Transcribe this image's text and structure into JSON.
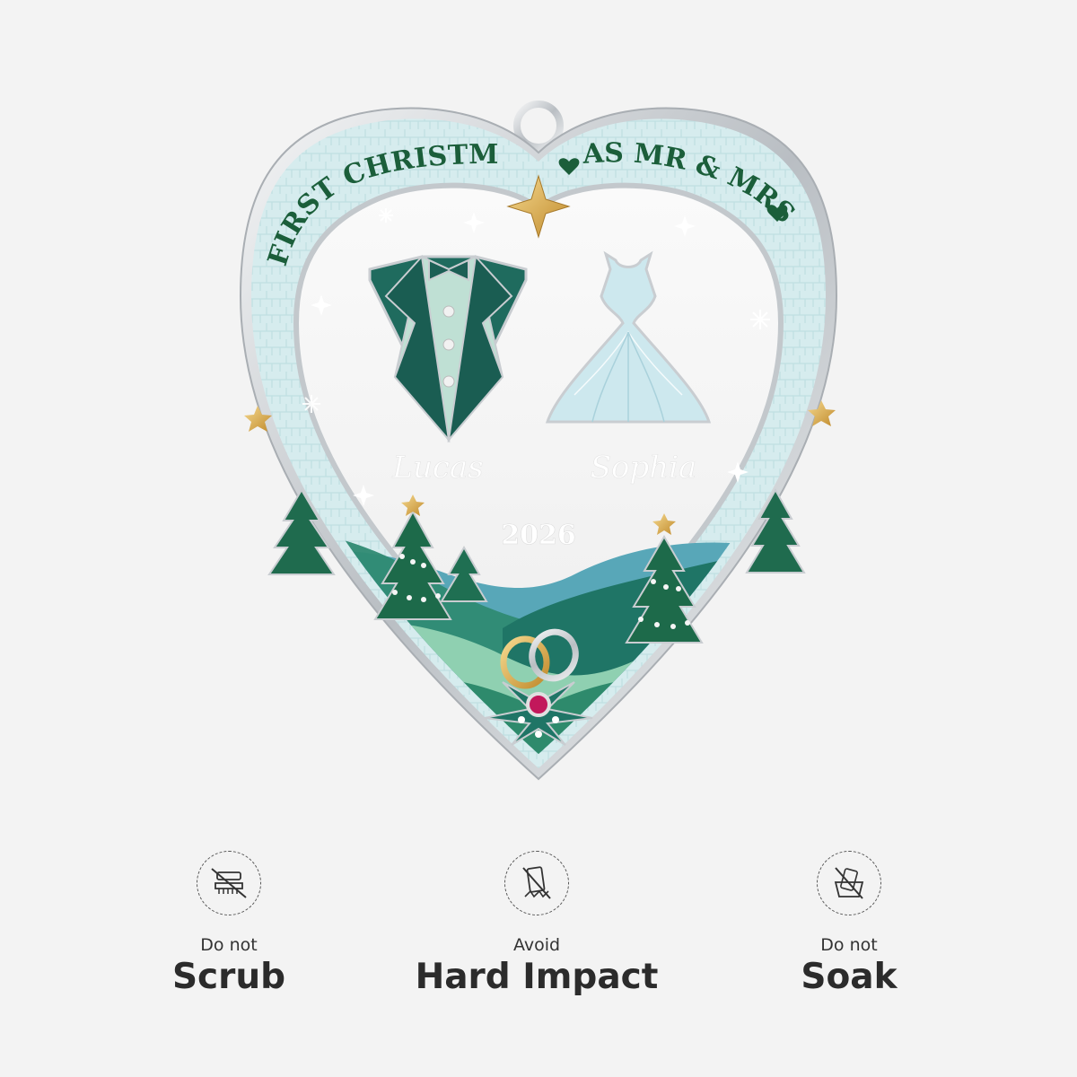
{
  "ornament": {
    "arc_left": "FIRST CHRISTMAS",
    "arc_right": "AS MR & MRS",
    "name_left": "Lucas",
    "name_right": "Sophia",
    "year": "2026"
  },
  "care": [
    {
      "small": "Do not",
      "big": "Scrub",
      "icon": "no-scrub-icon"
    },
    {
      "small": "Avoid",
      "big": "Hard Impact",
      "icon": "no-impact-icon"
    },
    {
      "small": "Do not",
      "big": "Soak",
      "icon": "no-soak-icon"
    }
  ],
  "colors": {
    "background": "#f3f3f3",
    "enamel_frame": "#d9eef0",
    "emerald": "#1f6b5e",
    "dark_green": "#1b5e3a",
    "silver": "#c9cdd1",
    "gold": "#d7a64a",
    "ruby": "#c2185b"
  }
}
